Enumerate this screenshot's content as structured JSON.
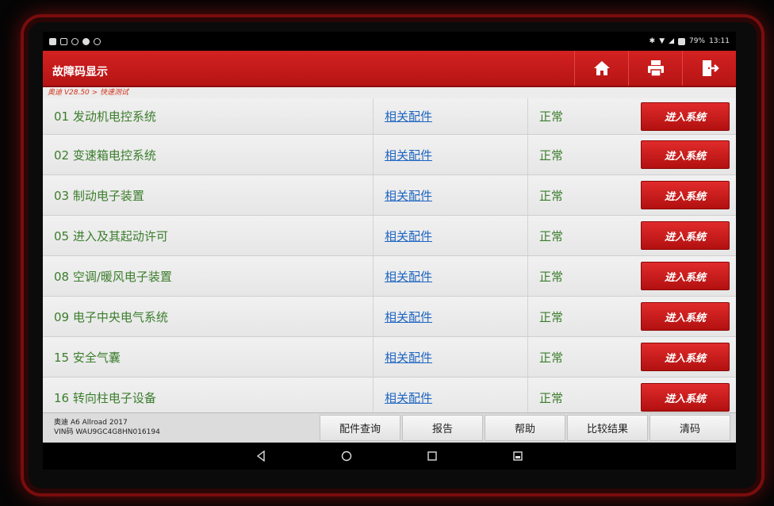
{
  "status_bar": {
    "battery": "79%",
    "time": "13:11"
  },
  "header": {
    "title": "故障码显示"
  },
  "breadcrumb": "奥迪 V28.50 > 快速测试",
  "systems": [
    {
      "name": "01 发动机电控系统",
      "parts_link": "相关配件",
      "status": "正常",
      "enter_label": "进入系统"
    },
    {
      "name": "02 变速箱电控系统",
      "parts_link": "相关配件",
      "status": "正常",
      "enter_label": "进入系统"
    },
    {
      "name": "03 制动电子装置",
      "parts_link": "相关配件",
      "status": "正常",
      "enter_label": "进入系统"
    },
    {
      "name": "05 进入及其起动许可",
      "parts_link": "相关配件",
      "status": "正常",
      "enter_label": "进入系统"
    },
    {
      "name": "08 空调/暖风电子装置",
      "parts_link": "相关配件",
      "status": "正常",
      "enter_label": "进入系统"
    },
    {
      "name": "09 电子中央电气系统",
      "parts_link": "相关配件",
      "status": "正常",
      "enter_label": "进入系统"
    },
    {
      "name": "15 安全气囊",
      "parts_link": "相关配件",
      "status": "正常",
      "enter_label": "进入系统"
    },
    {
      "name": "16 转向柱电子设备",
      "parts_link": "相关配件",
      "status": "正常",
      "enter_label": "进入系统"
    }
  ],
  "vehicle": {
    "model": "奥迪 A6 Allroad 2017",
    "vin": "VIN码 WAU9GC4G8HN016194"
  },
  "bottom_buttons": {
    "parts_query": "配件查询",
    "report": "报告",
    "help": "帮助",
    "compare": "比较结果",
    "clear": "清码"
  },
  "colors": {
    "title_bar": "#c61a1a",
    "enter_button": "#c81919",
    "system_text": "#3b7d2c",
    "link_text": "#1f66c2"
  },
  "icons": {
    "home": "home-icon",
    "print": "print-icon",
    "exit": "exit-icon",
    "back": "back-icon",
    "home_nav": "home-circle-icon",
    "recents": "recents-icon",
    "screenshot": "screenshot-icon"
  }
}
